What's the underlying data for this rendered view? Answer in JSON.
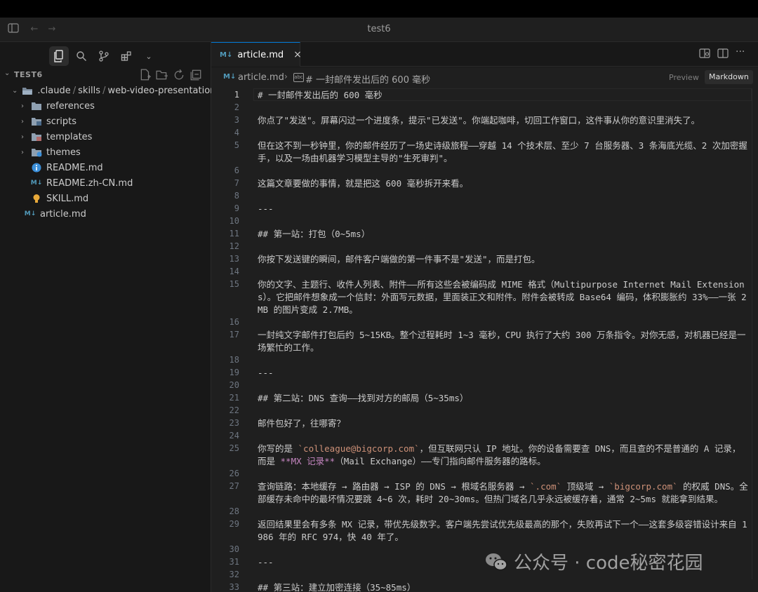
{
  "window": {
    "title": "test6"
  },
  "sidebar": {
    "workspace": "TEST6",
    "tree": [
      {
        "kind": "path",
        "parts": [
          ".claude",
          "skills",
          "web-video-presentation"
        ],
        "depth": 1,
        "open": true
      },
      {
        "kind": "folder",
        "label": "references",
        "depth": 2,
        "icon": "folder-icon"
      },
      {
        "kind": "folder",
        "label": "scripts",
        "depth": 2,
        "icon": "folder-scripts-icon"
      },
      {
        "kind": "folder",
        "label": "templates",
        "depth": 2,
        "icon": "folder-templates-icon"
      },
      {
        "kind": "folder",
        "label": "themes",
        "depth": 2,
        "icon": "folder-themes-icon"
      },
      {
        "kind": "file",
        "label": "README.md",
        "depth": 2,
        "icon": "info-icon"
      },
      {
        "kind": "file",
        "label": "README.zh-CN.md",
        "depth": 2,
        "icon": "markdown-icon"
      },
      {
        "kind": "file",
        "label": "SKILL.md",
        "depth": 2,
        "icon": "lightbulb-icon"
      },
      {
        "kind": "file",
        "label": "article.md",
        "depth": 1,
        "icon": "markdown-icon"
      }
    ]
  },
  "tab": {
    "label": "article.md",
    "icon": "M↓"
  },
  "breadcrumb": {
    "file": "article.md",
    "heading": "# 一封邮件发出后的 600 毫秒",
    "preview": "Preview",
    "markdown": "Markdown"
  },
  "editor": {
    "current_line": 1,
    "lines": [
      {
        "n": 1,
        "rows": 1,
        "spans": [
          {
            "t": "# 一封邮件发出后的 600 毫秒"
          }
        ]
      },
      {
        "n": 2,
        "rows": 1,
        "spans": []
      },
      {
        "n": 3,
        "rows": 1,
        "spans": [
          {
            "t": "你点了\"发送\"。屏幕闪过一个进度条，提示\"已发送\"。你端起咖啡，切回工作窗口，这件事从你的意识里消失了。"
          }
        ]
      },
      {
        "n": 4,
        "rows": 1,
        "spans": []
      },
      {
        "n": 5,
        "rows": 2,
        "spans": [
          {
            "t": "但在这不到一秒钟里，你的邮件经历了一场史诗级旅程——穿越 14 个技术层、至少 7 台服务器、3 条海底光缆、2 次加密握手，以及一场由机器学习模型主导的\"生死审判\"。"
          }
        ]
      },
      {
        "n": 6,
        "rows": 1,
        "spans": []
      },
      {
        "n": 7,
        "rows": 1,
        "spans": [
          {
            "t": "这篇文章要做的事情，就是把这 600 毫秒拆开来看。"
          }
        ]
      },
      {
        "n": 8,
        "rows": 1,
        "spans": []
      },
      {
        "n": 9,
        "rows": 1,
        "spans": [
          {
            "t": "---"
          }
        ]
      },
      {
        "n": 10,
        "rows": 1,
        "spans": []
      },
      {
        "n": 11,
        "rows": 1,
        "spans": [
          {
            "t": "## 第一站：打包（0~5ms）"
          }
        ]
      },
      {
        "n": 12,
        "rows": 1,
        "spans": []
      },
      {
        "n": 13,
        "rows": 1,
        "spans": [
          {
            "t": "你按下发送键的瞬间，邮件客户端做的第一件事不是\"发送\"，而是打包。"
          }
        ]
      },
      {
        "n": 14,
        "rows": 1,
        "spans": []
      },
      {
        "n": 15,
        "rows": 3,
        "spans": [
          {
            "t": "你的文字、主题行、收件人列表、附件——所有这些会被编码成 MIME 格式（Multipurpose Internet Mail Extensions）。它把邮件想象成一个信封：外面写元数据，里面装正文和附件。附件会被转成 Base64 编码，体积膨胀约 33%——一张 2MB 的图片变成 2.7MB。"
          }
        ]
      },
      {
        "n": 16,
        "rows": 1,
        "spans": []
      },
      {
        "n": 17,
        "rows": 2,
        "spans": [
          {
            "t": "一封纯文字邮件打包后约 5~15KB。整个过程耗时 1~3 毫秒，CPU 执行了大约 300 万条指令。对你无感，对机器已经是一场繁忙的工作。"
          }
        ]
      },
      {
        "n": 18,
        "rows": 1,
        "spans": []
      },
      {
        "n": 19,
        "rows": 1,
        "spans": [
          {
            "t": "---"
          }
        ]
      },
      {
        "n": 20,
        "rows": 1,
        "spans": []
      },
      {
        "n": 21,
        "rows": 1,
        "spans": [
          {
            "t": "## 第二站：DNS 查询——找到对方的邮局（5~35ms）"
          }
        ]
      },
      {
        "n": 22,
        "rows": 1,
        "spans": []
      },
      {
        "n": 23,
        "rows": 1,
        "spans": [
          {
            "t": "邮件包好了，往哪寄？"
          }
        ]
      },
      {
        "n": 24,
        "rows": 1,
        "spans": []
      },
      {
        "n": 25,
        "rows": 2,
        "spans": [
          {
            "t": "你写的是 "
          },
          {
            "t": "`colleague@bigcorp.com`",
            "c": "code"
          },
          {
            "t": "，但互联网只认 IP 地址。你的设备需要查 DNS，而且查的不是普通的 A 记录，而是 "
          },
          {
            "t": "**MX 记录**",
            "c": "bold"
          },
          {
            "t": "（Mail Exchange）——专门指向邮件服务器的路标。"
          }
        ]
      },
      {
        "n": 26,
        "rows": 1,
        "spans": []
      },
      {
        "n": 27,
        "rows": 2,
        "spans": [
          {
            "t": "查询链路：本地缓存 → 路由器 → ISP 的 DNS → 根域名服务器 → "
          },
          {
            "t": "`.com`",
            "c": "code"
          },
          {
            "t": " 顶级域 → "
          },
          {
            "t": "`bigcorp.com`",
            "c": "code"
          },
          {
            "t": " 的权威 DNS。全部缓存未命中的最坏情况要跳 4~6 次，耗时 20~30ms。但热门域名几乎永远被缓存着，通常 2~5ms 就能拿到结果。"
          }
        ]
      },
      {
        "n": 28,
        "rows": 1,
        "spans": []
      },
      {
        "n": 29,
        "rows": 2,
        "spans": [
          {
            "t": "返回结果里会有多条 MX 记录，带优先级数字。客户端先尝试优先级最高的那个，失败再试下一个——这套多级容错设计来自 1986 年的 RFC 974，快 40 年了。"
          }
        ]
      },
      {
        "n": 30,
        "rows": 1,
        "spans": []
      },
      {
        "n": 31,
        "rows": 1,
        "spans": [
          {
            "t": "---"
          }
        ]
      },
      {
        "n": 32,
        "rows": 1,
        "spans": []
      },
      {
        "n": 33,
        "rows": 1,
        "spans": [
          {
            "t": "## 第三站：建立加密连接（35~85ms）"
          }
        ]
      }
    ]
  },
  "watermark": {
    "text": "公众号 · code秘密花园"
  }
}
